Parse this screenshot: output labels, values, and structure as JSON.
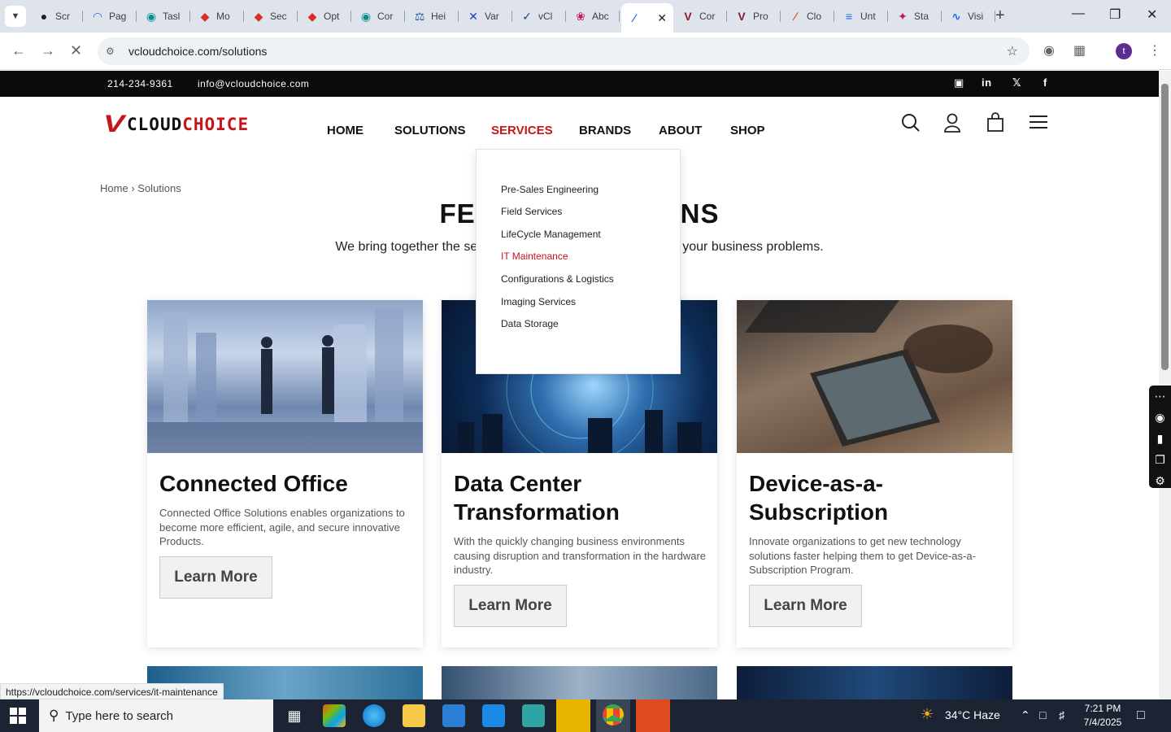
{
  "browser": {
    "tabs": [
      {
        "label": "Scr",
        "color": "#202124",
        "glyph": "●"
      },
      {
        "label": "Pag",
        "color": "#1a73e8",
        "glyph": "◠"
      },
      {
        "label": "Tasl",
        "color": "#0a8f8f",
        "glyph": "◉"
      },
      {
        "label": "Mo",
        "color": "#d93025",
        "glyph": "◆"
      },
      {
        "label": "Sec",
        "color": "#d93025",
        "glyph": "◆"
      },
      {
        "label": "Opt",
        "color": "#d93025",
        "glyph": "◆"
      },
      {
        "label": "Cor",
        "color": "#0a8f8f",
        "glyph": "◉"
      },
      {
        "label": "Hei",
        "color": "#1a5fa8",
        "glyph": "⚖"
      },
      {
        "label": "Var",
        "color": "#1a3fc4",
        "glyph": "✕"
      },
      {
        "label": "vCl",
        "color": "#1a3f7a",
        "glyph": "✓"
      },
      {
        "label": "Abc",
        "color": "#c2185b",
        "glyph": "❀"
      },
      {
        "label": "",
        "color": "#1a73e8",
        "glyph": "∕"
      },
      {
        "label": "Cor",
        "color": "#8b1a2b",
        "glyph": "V"
      },
      {
        "label": "Pro",
        "color": "#8b1a2b",
        "glyph": "V"
      },
      {
        "label": "Clo",
        "color": "#e8501a",
        "glyph": "∕"
      },
      {
        "label": "Unt",
        "color": "#1a73e8",
        "glyph": "≡"
      },
      {
        "label": "Sta",
        "color": "#c2185b",
        "glyph": "✦"
      },
      {
        "label": "Visi",
        "color": "#1a73e8",
        "glyph": "∿"
      }
    ],
    "url": "vcloudchoice.com/solutions",
    "status_url": "https://vcloudchoice.com/services/it-maintenance",
    "profile_initial": "t"
  },
  "site": {
    "topbar": {
      "phone": "214-234-9361",
      "email": "info@vcloudchoice.com",
      "social": [
        "instagram-icon",
        "linkedin-icon",
        "x-icon",
        "facebook-icon"
      ]
    },
    "logo": {
      "v": "V",
      "cloud": "CLOUD",
      "choice": "CHOICE"
    },
    "nav": [
      {
        "label": "HOME",
        "active": false
      },
      {
        "label": "SOLUTIONS",
        "active": false
      },
      {
        "label": "SERVICES",
        "active": true
      },
      {
        "label": "BRANDS",
        "active": false
      },
      {
        "label": "ABOUT",
        "active": false
      },
      {
        "label": "SHOP",
        "active": false
      }
    ],
    "breadcrumb": {
      "home": "Home",
      "sep": "›",
      "current": "Solutions"
    },
    "hero": {
      "title_left": "FE",
      "title_right": "NS",
      "sub_left": "We bring together the se",
      "sub_right": "your business problems."
    },
    "services_menu": [
      {
        "label": "Pre-Sales Engineering",
        "hover": false
      },
      {
        "label": "Field Services",
        "hover": false
      },
      {
        "label": "LifeCycle Management",
        "hover": false
      },
      {
        "label": "IT Maintenance",
        "hover": true
      },
      {
        "label": "Configurations & Logistics",
        "hover": false
      },
      {
        "label": "Imaging Services",
        "hover": false
      },
      {
        "label": "Data Storage",
        "hover": false
      }
    ],
    "cards": [
      {
        "title": "Connected Office",
        "desc": "Connected Office Solutions enables organizations to become more efficient, agile, and secure innovative Products.",
        "button": "Learn More"
      },
      {
        "title": "Data Center Transformation",
        "desc": "With the quickly changing business environments causing disruption and transformation in the hardware industry.",
        "button": "Learn More"
      },
      {
        "title": "Device-as-a-Subscription",
        "desc": "Innovate organizations to get new technology solutions faster helping them to get Device-as-a-Subscription Program.",
        "button": "Learn More"
      }
    ]
  },
  "taskbar": {
    "search_placeholder": "Type here to search",
    "weather": "34°C  Haze",
    "time": "7:21 PM",
    "date": "7/4/2025"
  }
}
